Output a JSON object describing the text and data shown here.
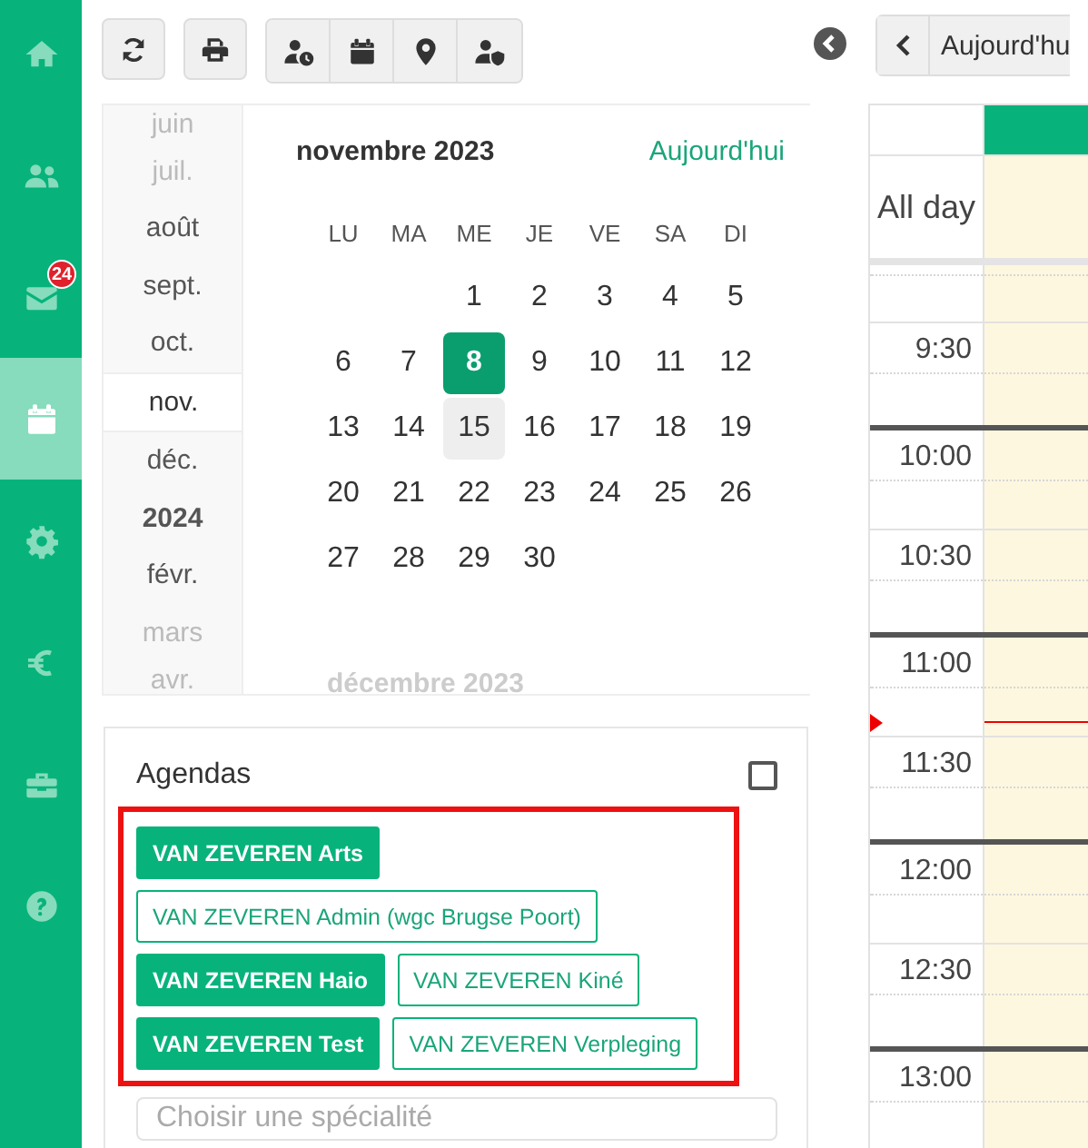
{
  "sidebar": {
    "items": [
      {
        "kind": "home",
        "selected": false
      },
      {
        "kind": "users",
        "selected": false
      },
      {
        "kind": "mail",
        "selected": false,
        "badge": "24"
      },
      {
        "kind": "calendar",
        "selected": true
      },
      {
        "kind": "gear",
        "selected": false
      },
      {
        "kind": "euro",
        "selected": false
      },
      {
        "kind": "toolbox",
        "selected": false
      },
      {
        "kind": "help",
        "selected": false
      }
    ]
  },
  "toolbar": {
    "buttons": [
      {
        "kind": "refresh"
      },
      {
        "kind": "print"
      }
    ],
    "group": [
      {
        "kind": "user-clock"
      },
      {
        "kind": "calendar"
      },
      {
        "kind": "marker"
      },
      {
        "kind": "user-shield"
      }
    ],
    "today_button": "Aujourd'hu"
  },
  "month_list": [
    {
      "label": "juin",
      "kind": "month",
      "faded": true,
      "selected": false
    },
    {
      "label": "juil.",
      "kind": "month",
      "faded": true,
      "selected": false
    },
    {
      "label": "août",
      "kind": "month",
      "faded": false,
      "selected": false
    },
    {
      "label": "sept.",
      "kind": "month",
      "faded": false,
      "selected": false
    },
    {
      "label": "oct.",
      "kind": "month",
      "faded": false,
      "selected": false
    },
    {
      "label": "nov.",
      "kind": "month",
      "faded": false,
      "selected": true
    },
    {
      "label": "déc.",
      "kind": "month",
      "faded": false,
      "selected": false
    },
    {
      "label": "2024",
      "kind": "year",
      "faded": false,
      "selected": false
    },
    {
      "label": "févr.",
      "kind": "month",
      "faded": false,
      "selected": false
    },
    {
      "label": "mars",
      "kind": "month",
      "faded": true,
      "selected": false
    },
    {
      "label": "avr.",
      "kind": "month",
      "faded": true,
      "selected": false
    }
  ],
  "mini_calendar": {
    "title": "novembre 2023",
    "today_link": "Aujourd'hui",
    "weekdays": [
      "LU",
      "MA",
      "ME",
      "JE",
      "VE",
      "SA",
      "DI"
    ],
    "weeks": [
      [
        {
          "label": "1",
          "selected": false,
          "hovered": false
        },
        {
          "label": "2",
          "selected": false,
          "hovered": false
        },
        {
          "label": "3",
          "selected": false,
          "hovered": false
        },
        {
          "label": "4",
          "selected": false,
          "hovered": false
        },
        {
          "label": "5",
          "selected": false,
          "hovered": false
        }
      ],
      [
        {
          "label": "6",
          "selected": false,
          "hovered": false
        },
        {
          "label": "7",
          "selected": false,
          "hovered": false
        },
        {
          "label": "8",
          "selected": true,
          "hovered": false
        },
        {
          "label": "9",
          "selected": false,
          "hovered": false
        },
        {
          "label": "10",
          "selected": false,
          "hovered": false
        },
        {
          "label": "11",
          "selected": false,
          "hovered": false
        },
        {
          "label": "12",
          "selected": false,
          "hovered": false
        }
      ],
      [
        {
          "label": "13",
          "selected": false,
          "hovered": false
        },
        {
          "label": "14",
          "selected": false,
          "hovered": false
        },
        {
          "label": "15",
          "selected": false,
          "hovered": true
        },
        {
          "label": "16",
          "selected": false,
          "hovered": false
        },
        {
          "label": "17",
          "selected": false,
          "hovered": false
        },
        {
          "label": "18",
          "selected": false,
          "hovered": false
        },
        {
          "label": "19",
          "selected": false,
          "hovered": false
        }
      ],
      [
        {
          "label": "20",
          "selected": false,
          "hovered": false
        },
        {
          "label": "21",
          "selected": false,
          "hovered": false
        },
        {
          "label": "22",
          "selected": false,
          "hovered": false
        },
        {
          "label": "23",
          "selected": false,
          "hovered": false
        },
        {
          "label": "24",
          "selected": false,
          "hovered": false
        },
        {
          "label": "25",
          "selected": false,
          "hovered": false
        },
        {
          "label": "26",
          "selected": false,
          "hovered": false
        }
      ],
      [
        {
          "label": "27",
          "selected": false,
          "hovered": false
        },
        {
          "label": "28",
          "selected": false,
          "hovered": false
        },
        {
          "label": "29",
          "selected": false,
          "hovered": false
        },
        {
          "label": "30",
          "selected": false,
          "hovered": false
        }
      ]
    ],
    "next_title": "décembre 2023"
  },
  "agendas": {
    "title": "Agendas",
    "select_all": {
      "checked": false
    },
    "highlighted": true,
    "items": [
      {
        "label": "VAN ZEVEREN Arts",
        "selected": true
      },
      {
        "label": "VAN ZEVEREN Admin (wgc Brugse Poort)",
        "selected": false
      },
      {
        "label": "VAN ZEVEREN Haio",
        "selected": true
      },
      {
        "label": "VAN ZEVEREN Kiné",
        "selected": false
      },
      {
        "label": "VAN ZEVEREN Test",
        "selected": true
      },
      {
        "label": "VAN ZEVEREN Verpleging",
        "selected": false
      }
    ],
    "specialty_field": {
      "placeholder": "Choisir une spécialité"
    }
  },
  "day_view": {
    "all_day_label": "All day",
    "slots": [
      {
        "label": "9:30",
        "now_line": false
      },
      {
        "label": "10:00",
        "now_line": false
      },
      {
        "label": "10:30",
        "now_line": false
      },
      {
        "label": "11:00",
        "now_line": true
      },
      {
        "label": "11:30",
        "now_line": false
      },
      {
        "label": "12:00",
        "now_line": false
      },
      {
        "label": "12:30",
        "now_line": false
      },
      {
        "label": "13:00",
        "now_line": false
      }
    ]
  }
}
